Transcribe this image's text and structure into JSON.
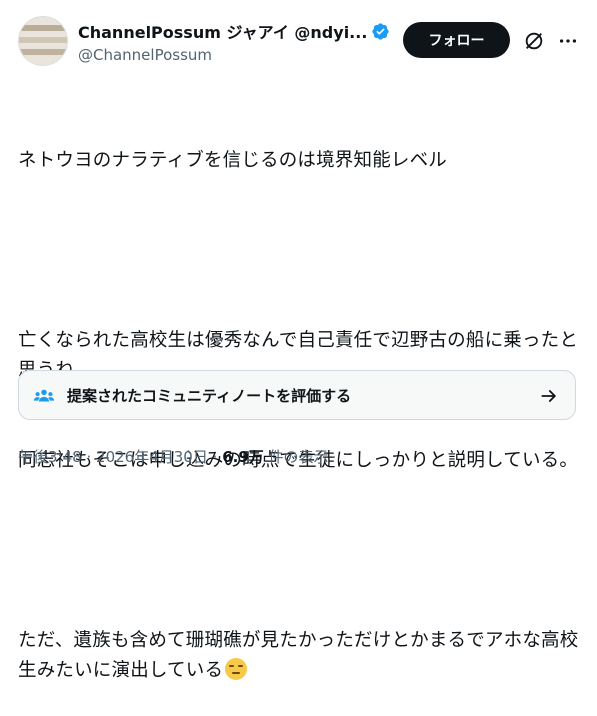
{
  "author": {
    "display_name": "ChannelPossum ジャアイ @ndyi...",
    "handle": "@ChannelPossum",
    "verified": true
  },
  "actions": {
    "follow_label": "フォロー",
    "grok_icon": "grok-slash-circle-icon",
    "more_icon": "more-horizontal-icon"
  },
  "tweet": {
    "lines": [
      "ネトウヨのナラティブを信じるのは境界知能レベル",
      "",
      "亡くなられた高校生は優秀なんで自己責任で辺野古の船に乗ったと思うね。",
      "同志社もそこは申し込みの時点で生徒にしっかりと説明している。",
      "",
      "ただ、遺族も含めて珊瑚礁が見たかっただけとかまるでアホな高校生みたいに演出している"
    ],
    "emoji": "😔"
  },
  "community_note": {
    "label": "提案されたコミュニティノートを評価する",
    "icon": "people-icon",
    "arrow_icon": "arrow-right-icon"
  },
  "meta": {
    "time": "午後3:48",
    "date": "2026年4月30日",
    "separator": "·",
    "views_count": "6.9万",
    "views_label": "件の表示"
  },
  "colors": {
    "text": "#0f1419",
    "secondary": "#536471",
    "verified": "#1d9bf0",
    "follow_bg": "#0f1419"
  }
}
